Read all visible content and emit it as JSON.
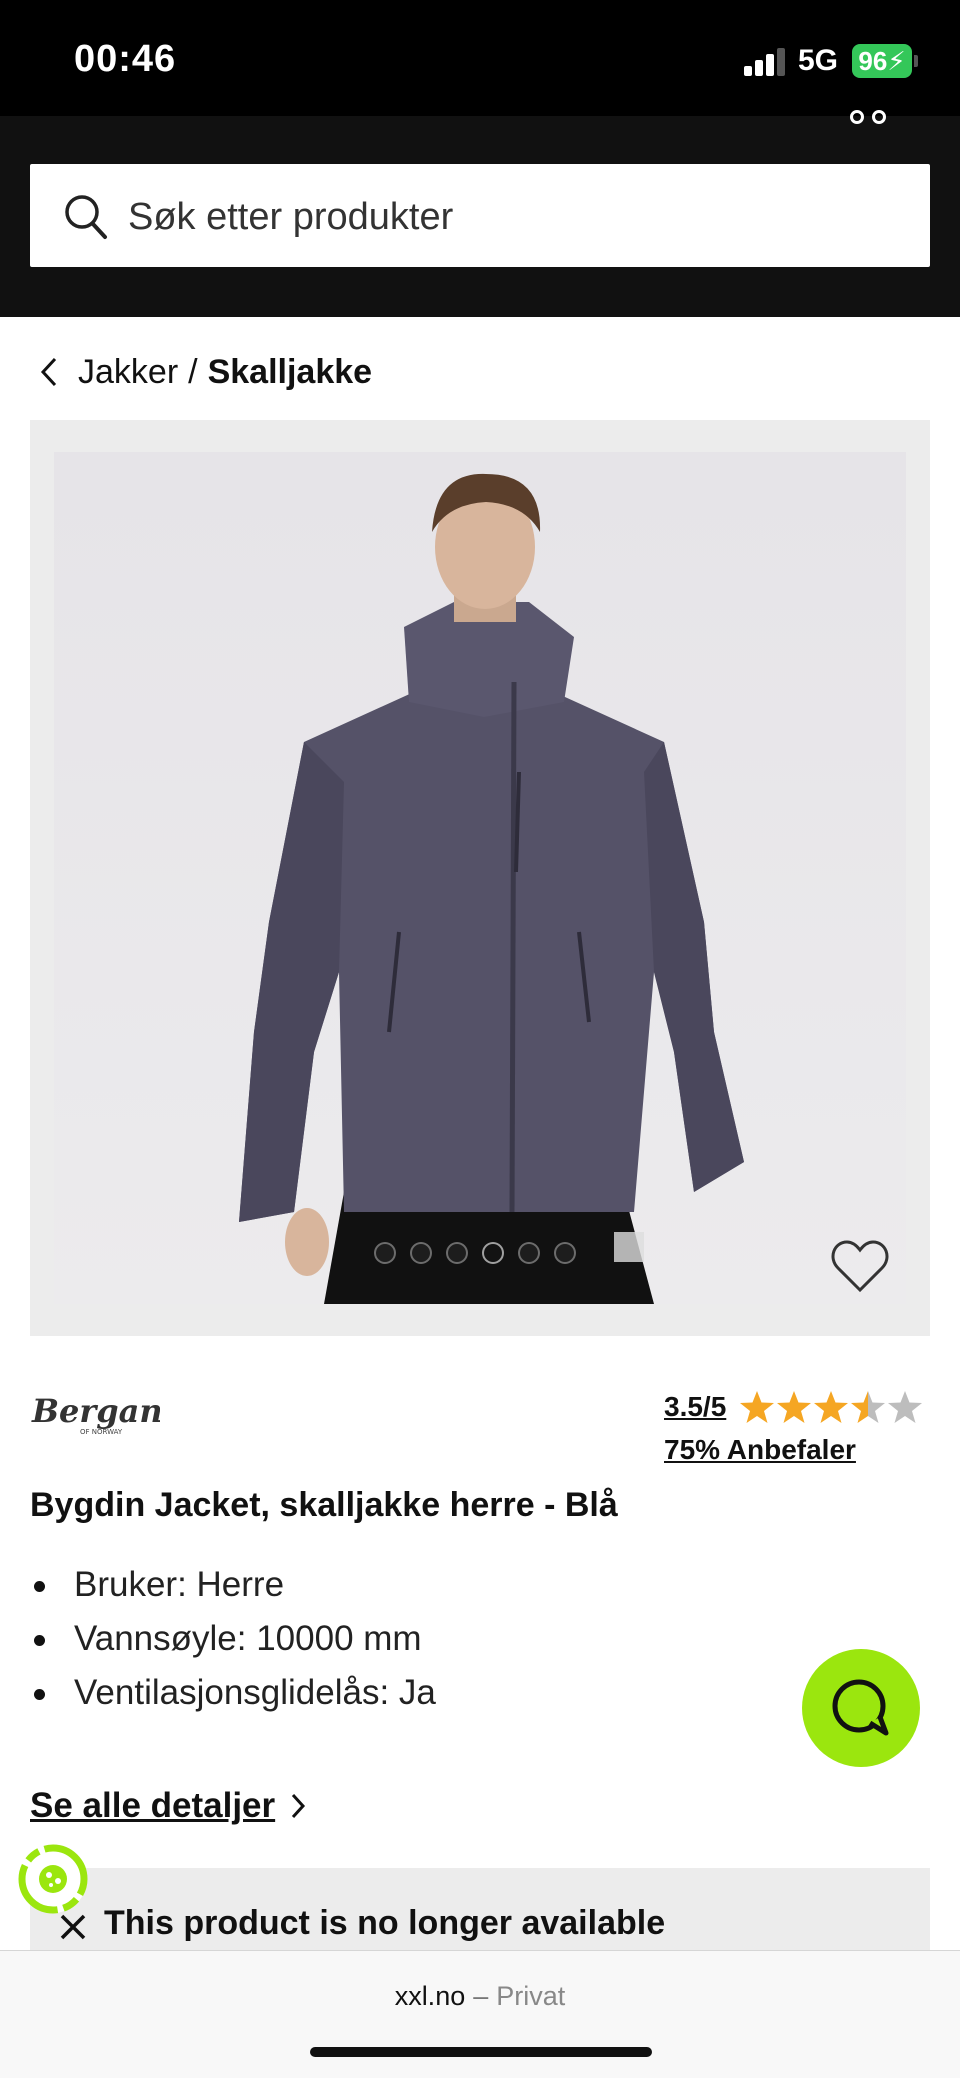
{
  "status_bar": {
    "time": "00:46",
    "network": "5G",
    "battery": "96"
  },
  "search": {
    "placeholder": "Søk etter produkter"
  },
  "breadcrumb": {
    "parent": "Jakker",
    "separator": "/",
    "current": "Skalljakke"
  },
  "gallery": {
    "image_count": 6,
    "active_index": 3
  },
  "product": {
    "brand": "Bergans",
    "brand_sub": "OF NORWAY",
    "rating": "3.5/5",
    "rating_value": 3.5,
    "rating_max": 5,
    "recommend": "75% Anbefaler",
    "title": "Bygdin Jacket, skalljakke herre - Blå",
    "specs": [
      "Bruker: Herre",
      "Vannsøyle: 10000 mm",
      "Ventilasjonsglidelås: Ja"
    ],
    "details_link": "Se alle detaljer",
    "unavailable": "This product is no longer available"
  },
  "colors": {
    "accent": "#9be60e",
    "star": "#f5a623",
    "header": "#111111"
  },
  "browser": {
    "domain": "xxl.no",
    "separator": "–",
    "mode": "Privat"
  }
}
